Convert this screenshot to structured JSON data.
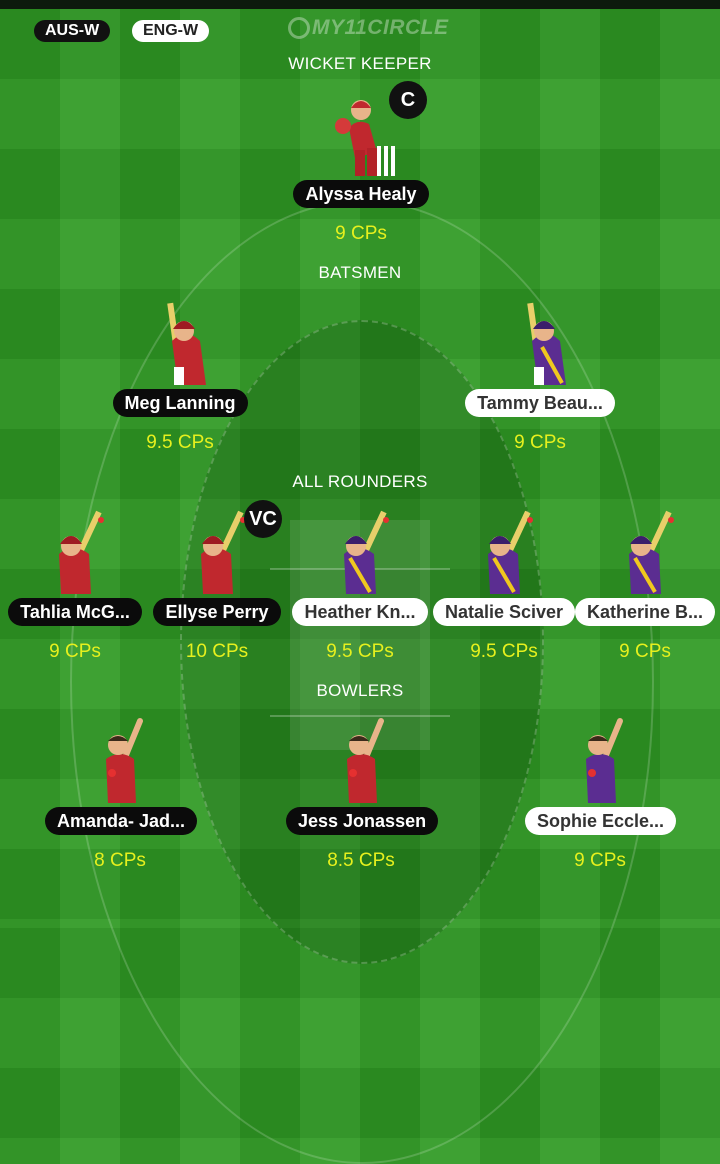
{
  "header": {
    "team_home": "AUS-W",
    "team_away": "ENG-W",
    "logo_text": "MY11CIRCLE"
  },
  "sections": {
    "wicket_keeper": "WICKET KEEPER",
    "batsmen": "BATSMEN",
    "all_rounders": "ALL ROUNDERS",
    "bowlers": "BOWLERS"
  },
  "badges": {
    "captain": "C",
    "vice_captain": "VC"
  },
  "players": {
    "wk1": {
      "name": "Alyssa Healy",
      "cps": "9 CPs",
      "team": "AUS-W",
      "icon": "wicketkeeper-icon"
    },
    "bat1": {
      "name": "Meg Lanning",
      "cps": "9.5 CPs",
      "team": "AUS-W",
      "icon": "batsman-icon"
    },
    "bat2": {
      "name": "Tammy Beau...",
      "cps": "9 CPs",
      "team": "ENG-W",
      "icon": "batsman-icon"
    },
    "ar1": {
      "name": "Tahlia McG...",
      "cps": "9 CPs",
      "team": "AUS-W",
      "icon": "allrounder-icon"
    },
    "ar2": {
      "name": "Ellyse Perry",
      "cps": "10 CPs",
      "team": "AUS-W",
      "icon": "allrounder-icon"
    },
    "ar3": {
      "name": "Heather Kn...",
      "cps": "9.5 CPs",
      "team": "ENG-W",
      "icon": "allrounder-icon"
    },
    "ar4": {
      "name": "Natalie Sciver",
      "cps": "9.5 CPs",
      "team": "ENG-W",
      "icon": "allrounder-icon"
    },
    "ar5": {
      "name": "Katherine B...",
      "cps": "9 CPs",
      "team": "ENG-W",
      "icon": "allrounder-icon"
    },
    "bowl1": {
      "name": "Amanda- Jad...",
      "cps": "8 CPs",
      "team": "AUS-W",
      "icon": "bowler-icon"
    },
    "bowl2": {
      "name": "Jess Jonassen",
      "cps": "8.5 CPs",
      "team": "AUS-W",
      "icon": "bowler-icon"
    },
    "bowl3": {
      "name": "Sophie Eccle...",
      "cps": "9 CPs",
      "team": "ENG-W",
      "icon": "bowler-icon"
    }
  },
  "colors": {
    "field_green": "#2f9a24",
    "credit_yellow": "#e6f01e",
    "aus_kit": "#c0282e",
    "eng_kit": "#5b2d91"
  }
}
